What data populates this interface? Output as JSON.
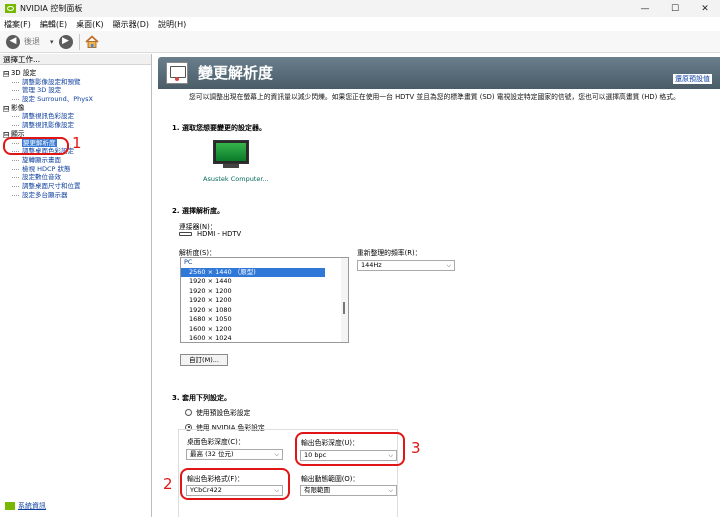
{
  "window": {
    "title": "NVIDIA 控制面板"
  },
  "window_controls": {
    "minimize": "—",
    "maximize": "☐",
    "close": "✕"
  },
  "menu": [
    "檔案(F)",
    "編輯(E)",
    "桌面(K)",
    "顯示器(D)",
    "說明(H)"
  ],
  "toolbar": {
    "back_label": "後退",
    "dropdown": "▾",
    "back_icon": "left-arrow",
    "forward_icon": "right-arrow",
    "home_icon": "home"
  },
  "sidebar": {
    "header": "選擇工作...",
    "categories": [
      {
        "label": "3D 設定",
        "expand": "⊟",
        "items": [
          "調整影像設定和預覽",
          "管理 3D 設定",
          "設定 Surround、PhysX"
        ]
      },
      {
        "label": "影像",
        "expand": "⊟",
        "items": [
          "調整視訊色彩設定",
          "調整視訊影像設定"
        ]
      },
      {
        "label": "顯示",
        "expand": "⊟",
        "items": [
          "變更解析度",
          "調整桌面色彩設定",
          "旋轉顯示畫面",
          "檢視 HDCP 狀態",
          "設定數位音效",
          "調整桌面尺寸和位置",
          "設定多台顯示器"
        ]
      }
    ],
    "selected": "變更解析度",
    "system_info": "系統資訊"
  },
  "page": {
    "title": "變更解析度",
    "restore": "還原預設值",
    "description": "您可以調整出現在螢幕上的資訊量以減少閃爍。如果您正在使用一台 HDTV 並且為您的標準畫質 (SD) 電視設定特定國家的信號，您也可以選擇高畫質 (HD) 格式。"
  },
  "section1": {
    "title": "1. 選取您想要變更的設定器。",
    "monitor_label": "Asustek Computer..."
  },
  "section2": {
    "title": "2. 選擇解析度。",
    "connector_label": "連接器(N)：",
    "connector_value": "HDMI - HDTV",
    "resolution_label": "解析度(S)：",
    "refresh_label": "重新整理的頻率(R)：",
    "refresh_value": "144Hz",
    "category": "PC",
    "resolutions": [
      "2560 × 1440 （原型)",
      "1920 × 1440",
      "1920 × 1200",
      "1920 × 1200",
      "1920 × 1080",
      "1680 × 1050",
      "1600 × 1200",
      "1600 × 1024"
    ],
    "custom_button": "自訂(M)..."
  },
  "section3": {
    "title": "3. 套用下列設定。",
    "radio_default": "使用預設色彩設定",
    "radio_nvidia": "使用 NVIDIA 色彩設定",
    "desktop_depth_label": "桌面色彩深度(C)：",
    "desktop_depth_value": "最高 (32 位元)",
    "output_depth_label": "輸出色彩深度(U)：",
    "output_depth_value": "10 bpc",
    "output_format_label": "輸出色彩格式(F)：",
    "output_format_value": "YCbCr422",
    "dynamic_range_label": "輸出動態範圍(O)：",
    "dynamic_range_value": "有限範圍"
  },
  "annotations": [
    "1",
    "2",
    "3"
  ],
  "colors": {
    "nvidia_green": "#76b900",
    "header_gray": "#5a6e7c",
    "annotation_red": "#e01616",
    "selection_blue": "#2f78d7"
  }
}
